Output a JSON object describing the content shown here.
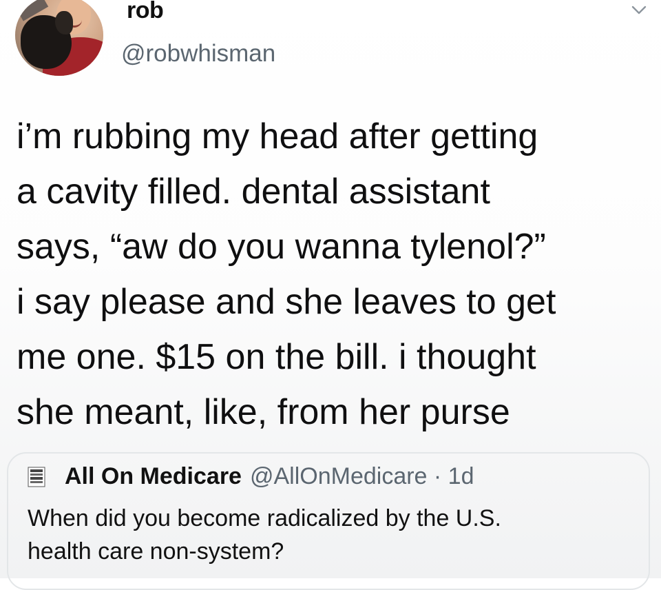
{
  "tweet": {
    "display_name": "rob",
    "handle": "@robwhisman",
    "lines": [
      "i’m rubbing my head after getting",
      "a cavity filled. dental assistant",
      "says, “aw do you wanna tylenol?”",
      "i say please and she leaves to get",
      "me one. $15 on the bill. i thought",
      "she meant, like, from her purse"
    ]
  },
  "menu": {
    "icon": "chevron-down-icon"
  },
  "quoted_tweet": {
    "display_name": "All On Medicare",
    "handle_time": "@AllOnMedicare · 1d",
    "lines": [
      "When did you become radicalized by the U.S.",
      "health care non-system?"
    ],
    "logo_icon": "medicare-portal-logo-icon"
  },
  "colors": {
    "text": "#111111",
    "secondary": "#5b6670",
    "border": "#e3e6e8"
  }
}
